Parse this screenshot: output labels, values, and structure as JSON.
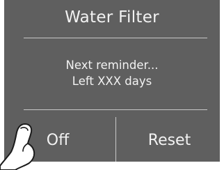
{
  "panel": {
    "title": "Water Filter",
    "message_line1": "Next reminder...",
    "message_line2": "Left XXX days"
  },
  "buttons": {
    "off_label": "Off",
    "reset_label": "Reset"
  },
  "icons": {
    "pointer": "pointing-hand-icon"
  },
  "colors": {
    "panel_bg": "#5f5f5f",
    "text": "#f2f2f2",
    "divider": "#c8c8c8"
  }
}
